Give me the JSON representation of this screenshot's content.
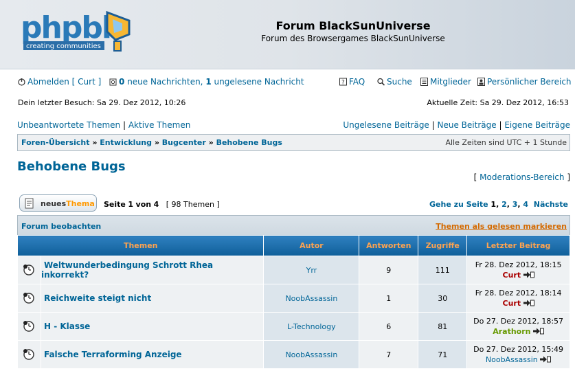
{
  "header": {
    "logo_text": "phpbb",
    "logo_tagline": "creating communities",
    "site_title": "Forum BlackSunUniverse",
    "site_description": "Forum des Browsergames BlackSunUniverse"
  },
  "userbar": {
    "logout": "Abmelden [ Curt ]",
    "new_pm_count": "0",
    "new_pm_text": "neue Nachrichten,",
    "unread_count": "1",
    "unread_text": "ungelesene Nachricht",
    "faq": "FAQ",
    "search": "Suche",
    "members": "Mitglieder",
    "ucp": "Persönlicher Bereich",
    "last_visit": "Dein letzter Besuch: Sa 29. Dez 2012, 10:26",
    "current_time": "Aktuelle Zeit: Sa 29. Dez 2012, 16:53"
  },
  "quicklinks": {
    "left": [
      "Unbeantwortete Themen",
      "Aktive Themen"
    ],
    "right": [
      "Ungelesene Beiträge",
      "Neue Beiträge",
      "Eigene Beiträge"
    ]
  },
  "breadcrumb": {
    "items": [
      "Foren-Übersicht",
      "Entwicklung",
      "Bugcenter",
      "Behobene Bugs"
    ],
    "timezone": "Alle Zeiten sind UTC + 1 Stunde"
  },
  "forum": {
    "title": "Behobene Bugs",
    "moderation": "Moderations-Bereich",
    "new_topic_a": "neues",
    "new_topic_b": "Thema",
    "page_label": "Seite",
    "page_current": "1",
    "page_of": "von",
    "page_total": "4",
    "topic_count": "[ 98 Themen ]",
    "goto": "Gehe zu Seite",
    "pages": [
      "1",
      "2",
      "3",
      "4"
    ],
    "next": "Nächste",
    "watch": "Forum beobachten",
    "mark_read": "Themen als gelesen markieren"
  },
  "table": {
    "headers": [
      "Themen",
      "Autor",
      "Antworten",
      "Zugriffe",
      "Letzter Beitrag"
    ],
    "rows": [
      {
        "title": "Weltwunderbedingung Schrott Rhea inkorrekt?",
        "author": "Yrr",
        "replies": "9",
        "views": "111",
        "last_date": "Fr 28. Dez 2012, 18:15",
        "last_user": "Curt"
      },
      {
        "title": "Reichweite steigt nicht",
        "author": "NoobAssassin",
        "replies": "1",
        "views": "30",
        "last_date": "Fr 28. Dez 2012, 18:14",
        "last_user": "Curt"
      },
      {
        "title": "H - Klasse",
        "author": "L-Technology",
        "replies": "6",
        "views": "81",
        "last_date": "Do 27. Dez 2012, 18:57",
        "last_user": "Arathorn"
      },
      {
        "title": "Falsche Terraforming Anzeige",
        "author": "NoobAssassin",
        "replies": "7",
        "views": "71",
        "last_date": "Do 27. Dez 2012, 15:49",
        "last_user": "NoobAssassin"
      }
    ]
  },
  "colors": {
    "link": "#006597",
    "curt": "#aa0000",
    "arathorn": "#669900",
    "accent": "#ff9900"
  }
}
